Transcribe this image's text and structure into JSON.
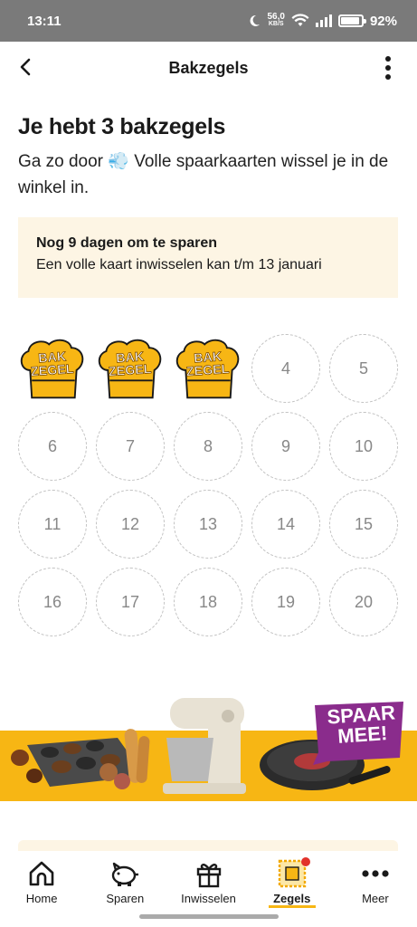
{
  "status": {
    "time": "13:11",
    "net_speed": "56,0",
    "net_unit": "KB/S",
    "battery": "92%"
  },
  "header": {
    "title": "Bakzegels"
  },
  "main": {
    "heading": "Je hebt 3 bakzegels",
    "subtitle_before": "Ga zo door",
    "subtitle_emoji": "💨",
    "subtitle_after": "Volle spaarkaarten wissel je in de winkel in.",
    "notice": {
      "title": "Nog 9 dagen om te sparen",
      "text": "Een volle kaart inwisselen kan t/m 13 januari"
    },
    "stamp_text_line1": "BAK",
    "stamp_text_line2": "ZEGEL",
    "collected": 3,
    "slots": [
      "1",
      "2",
      "3",
      "4",
      "5",
      "6",
      "7",
      "8",
      "9",
      "10",
      "11",
      "12",
      "13",
      "14",
      "15",
      "16",
      "17",
      "18",
      "19",
      "20"
    ]
  },
  "banner": {
    "badge_line1": "SPAAR",
    "badge_line2": "MEE!"
  },
  "nav": {
    "items": [
      {
        "label": "Home",
        "icon": "home-icon"
      },
      {
        "label": "Sparen",
        "icon": "piggy-bank-icon"
      },
      {
        "label": "Inwisselen",
        "icon": "gift-icon"
      },
      {
        "label": "Zegels",
        "icon": "stamp-icon"
      },
      {
        "label": "Meer",
        "icon": "more-dots-icon"
      }
    ],
    "active_index": 3
  },
  "colors": {
    "accent": "#f7b614",
    "notice_bg": "#fdf5e4",
    "badge": "#8a2c8c",
    "notification_dot": "#e2332b"
  }
}
